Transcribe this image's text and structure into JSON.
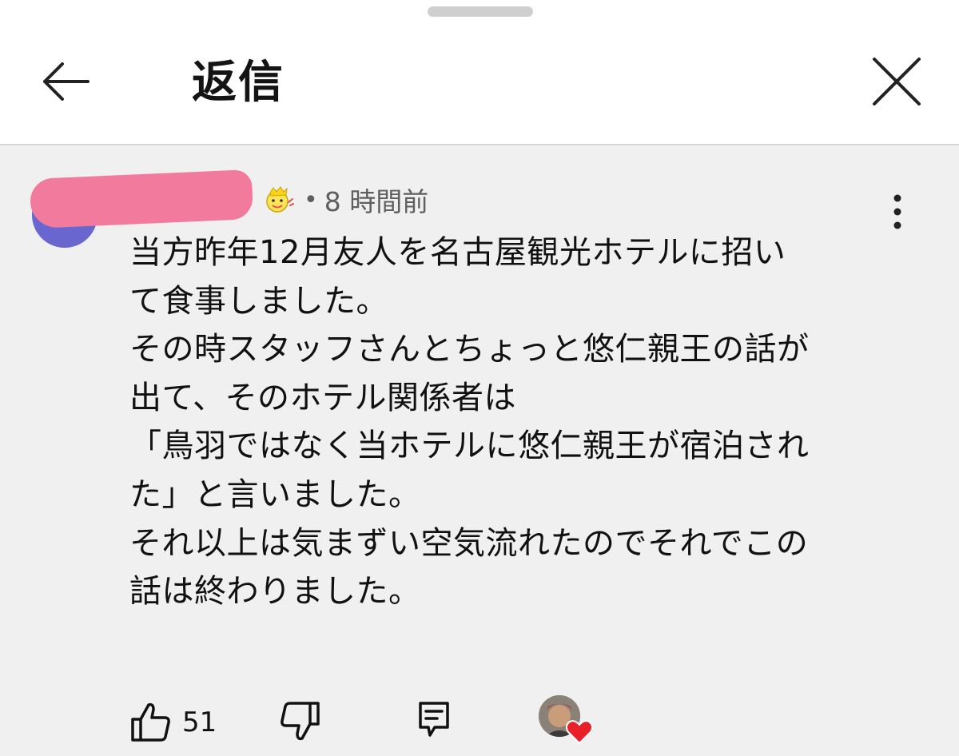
{
  "header": {
    "title": "返信"
  },
  "comment": {
    "time": "8 時間前",
    "separator": "•",
    "body_lines": [
      "当方昨年12月友人を名古屋観光ホテルに招い",
      "て食事しました。",
      "その時スタッフさんとちょっと悠仁親王の話が",
      "出て、そのホテル関係者は",
      "「鳥羽ではなく当ホテルに悠仁親王が宿泊され",
      "た」と言いました。",
      "それ以上は気まずい空気流れたのでそれでこの",
      "話は終わりました。"
    ],
    "likes": "51"
  },
  "colors": {
    "name_redaction": "#f27a9c",
    "avatar": "#6a66d0",
    "heart": "#e8202a"
  },
  "icons": {
    "back": "arrow-left",
    "close": "x",
    "more": "vertical-dots",
    "like": "thumbs-up",
    "dislike": "thumbs-down",
    "reply": "comment",
    "badge": "member-badge"
  }
}
